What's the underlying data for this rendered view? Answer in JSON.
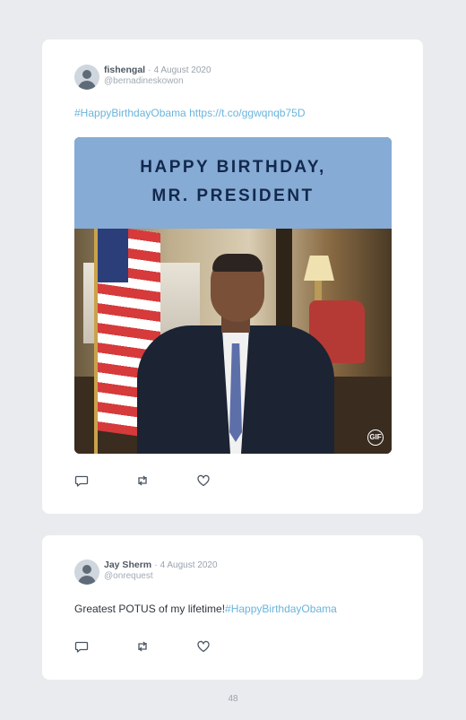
{
  "tweets": [
    {
      "author_name": "fishengal",
      "separator": "·",
      "date": "4 August 2020",
      "handle": "@bernadineskowon",
      "text_prefix": "",
      "text_link": "#HappyBirthdayObama https://t.co/ggwqnqb75D",
      "media": {
        "banner_line1": "HAPPY BIRTHDAY,",
        "banner_line2": "MR. PRESIDENT",
        "badge": "GIF"
      }
    },
    {
      "author_name": "Jay Sherm",
      "separator": "·",
      "date": "4 August 2020",
      "handle": "@onrequest",
      "text_prefix": "Greatest POTUS of my lifetime!",
      "text_link": "#HappyBirthdayObama"
    }
  ],
  "icons": {
    "reply": "reply-icon",
    "retweet": "retweet-icon",
    "like": "heart-icon"
  },
  "colors": {
    "link": "#6ab4dc",
    "banner": "#86abd5",
    "banner_text": "#13284d"
  },
  "page_number": "48"
}
